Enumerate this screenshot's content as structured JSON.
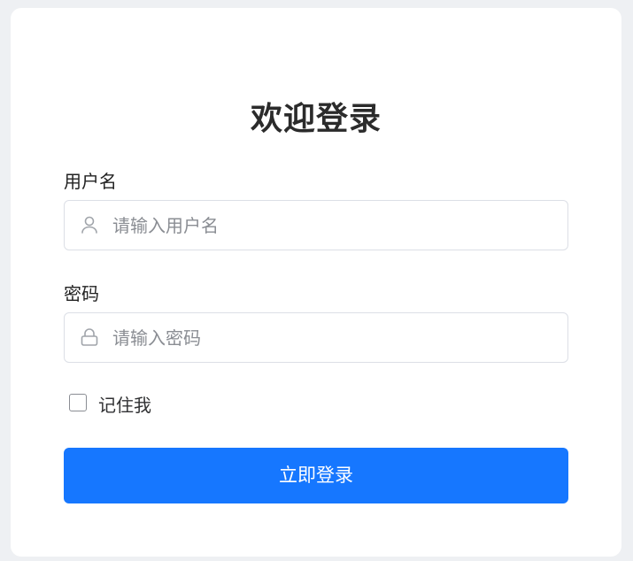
{
  "card": {
    "title": "欢迎登录"
  },
  "username": {
    "label": "用户名",
    "placeholder": "请输入用户名",
    "value": "",
    "icon": "user-icon"
  },
  "password": {
    "label": "密码",
    "placeholder": "请输入密码",
    "value": "",
    "icon": "lock-icon"
  },
  "remember": {
    "label": "记住我",
    "checked": false
  },
  "submit": {
    "label": "立即登录"
  },
  "colors": {
    "background": "#eef0f3",
    "card": "#ffffff",
    "primary": "#1677ff",
    "border": "#dcdfe6",
    "placeholder": "#8a8d93"
  }
}
